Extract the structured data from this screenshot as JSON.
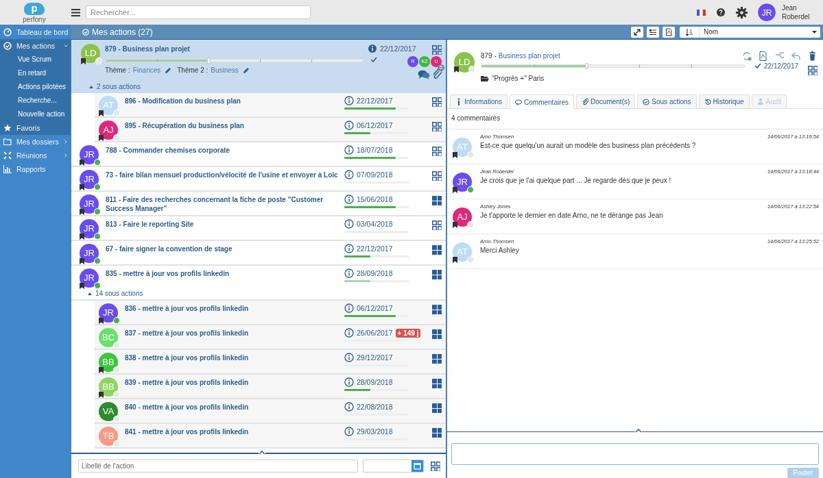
{
  "topbar": {
    "logo": {
      "mark": "p",
      "wordmark": "perfony"
    },
    "search": {
      "placeholder": "Rechercher..."
    },
    "user": {
      "initials": "JR",
      "name": "Jean Roberdel",
      "color": "#6a4cf0"
    }
  },
  "sidebar": {
    "items": [
      {
        "label": "Tableau de bord",
        "selected": false
      },
      {
        "label": "Mes actions",
        "selected": true,
        "expanded": true,
        "children": [
          {
            "label": "Vue Scrum"
          },
          {
            "label": "En retard"
          },
          {
            "label": "Actions pilotées"
          },
          {
            "label": "Recherche..."
          },
          {
            "label": "Nouvelle action"
          }
        ]
      },
      {
        "label": "Favoris",
        "selected": true
      },
      {
        "label": "Mes dossiers",
        "selected": false,
        "expanded": false
      },
      {
        "label": "Réunions",
        "selected": false,
        "expanded": false
      },
      {
        "label": "Rapports",
        "selected": false
      }
    ]
  },
  "list": {
    "title": "Mes actions (27)",
    "sort": {
      "value": "Nom"
    },
    "actions": [
      {
        "title": "879 - Business plan projet",
        "date": "22/12/2017",
        "avatar": {
          "initials": "LD",
          "color": "#8bc34a"
        },
        "online": false,
        "bookmarked": true,
        "selected": true,
        "level": 0.4,
        "board_filled": false,
        "themes": [
          {
            "label": "Thème :",
            "value": "Finances"
          },
          {
            "label": "Thème 2 :",
            "value": "Business"
          }
        ],
        "participants": [
          {
            "initials": "R",
            "color": "#6a4cf0"
          },
          {
            "initials": "KZ",
            "color": "#3cb93c"
          },
          {
            "initials": "U",
            "color": "#e0287a"
          }
        ],
        "attachments": "5",
        "subactions": "2 sous actions",
        "expanded": true,
        "children": [
          {
            "title": "896 - Modification du business plan",
            "date": "22/12/2017",
            "avatar": {
              "initials": "AT",
              "color": "#bcdcf7"
            },
            "online": false,
            "bookmarked": true,
            "selected": false,
            "level": 0.8,
            "board_filled": false
          },
          {
            "title": "895 - Récupération du business plan",
            "date": "06/12/2017",
            "avatar": {
              "initials": "AJ",
              "color": "#e0287a"
            },
            "online": false,
            "bookmarked": true,
            "selected": false,
            "level": 0.4,
            "board_filled": false
          }
        ]
      },
      {
        "title": "788 - Commander chemises corporate",
        "date": "18/07/2018",
        "avatar": {
          "initials": "JR",
          "color": "#6a4cf0"
        },
        "online": true,
        "bookmarked": true,
        "selected": false,
        "level": 0.8,
        "board_filled": false
      },
      {
        "title": "73 - faire bilan mensuel production/vélocité de l'usine et envoyer à Loïc",
        "date": "07/09/2018",
        "avatar": {
          "initials": "JR",
          "color": "#6a4cf0"
        },
        "online": true,
        "bookmarked": true,
        "selected": false,
        "level": 0,
        "board_filled": false
      },
      {
        "title": "811 - Faire des recherches concernant la fiche de poste \"Customer Success Manager\"",
        "date": "15/06/2018",
        "avatar": {
          "initials": "JR",
          "color": "#6a4cf0"
        },
        "online": true,
        "bookmarked": true,
        "selected": false,
        "level": 0.8,
        "board_filled": true
      },
      {
        "title": "813 - Faire le reporting Site",
        "date": "03/04/2018",
        "avatar": {
          "initials": "JR",
          "color": "#6a4cf0"
        },
        "online": true,
        "bookmarked": true,
        "selected": false,
        "level": 0,
        "board_filled": false
      },
      {
        "title": "67 - faire signer la convention de stage",
        "date": "22/12/2017",
        "avatar": {
          "initials": "JR",
          "color": "#6a4cf0"
        },
        "online": true,
        "bookmarked": true,
        "selected": false,
        "level": 0.4,
        "board_filled": true
      },
      {
        "title": "835 - mettre à jour vos profils linkedin",
        "date": "28/09/2018",
        "avatar": {
          "initials": "JR",
          "color": "#6a4cf0"
        },
        "online": true,
        "bookmarked": true,
        "selected": false,
        "level": 0.4,
        "board_filled": true,
        "subactions": "14 sous actions",
        "expanded": true,
        "children": [
          {
            "title": "836 - mettre à jour vos profils linkedin",
            "date": "06/12/2017",
            "avatar": {
              "initials": "JR",
              "color": "#6a4cf0"
            },
            "online": true,
            "bookmarked": true,
            "selected": false,
            "level": 0.8,
            "board_filled": true
          },
          {
            "title": "837 - mettre à jour vos profils linkedin",
            "date": "26/06/2017",
            "overdue": "+ 149 j",
            "avatar": {
              "initials": "BC",
              "color": "#6be06b"
            },
            "online": false,
            "bookmarked": false,
            "selected": false,
            "level": 0,
            "board_filled": true
          },
          {
            "title": "838 - mettre à jour vos profils linkedin",
            "date": "29/12/2017",
            "avatar": {
              "initials": "BB",
              "color": "#3cc63c"
            },
            "online": false,
            "bookmarked": true,
            "selected": false,
            "level": 0,
            "board_filled": true
          },
          {
            "title": "839 - mettre à jour vos profils linkedin",
            "date": "28/09/2018",
            "avatar": {
              "initials": "BB",
              "color": "#8fd460"
            },
            "online": false,
            "bookmarked": true,
            "selected": false,
            "level": 0.4,
            "board_filled": true
          },
          {
            "title": "840 - mettre à jour vos profils linkedin",
            "date": "22/08/2018",
            "avatar": {
              "initials": "VA",
              "color": "#2e8b2e"
            },
            "online": false,
            "bookmarked": false,
            "selected": false,
            "level": 0,
            "board_filled": true
          },
          {
            "title": "841 - mettre à jour vos profils linkedin",
            "date": "29/03/2018",
            "avatar": {
              "initials": "TB",
              "color": "#f99a85"
            },
            "online": false,
            "bookmarked": false,
            "selected": false,
            "level": 0,
            "board_filled": true
          }
        ]
      }
    ],
    "new_action": {
      "placeholder": "Libellé de l'action"
    }
  },
  "detail": {
    "prefix": "879 -",
    "title": "Business plan projet",
    "avatar": {
      "initials": "LD",
      "color": "#8bc34a"
    },
    "online": false,
    "bookmarked": true,
    "level": 0.4,
    "date": "22/12/2017",
    "done": true,
    "folder": "\"Progrès +\" Paris",
    "tabs": [
      {
        "label": "Informations",
        "selected": false,
        "disabled": false
      },
      {
        "label": "Commentaires",
        "selected": true,
        "disabled": false
      },
      {
        "label": "Document(s)",
        "selected": false,
        "disabled": false
      },
      {
        "label": "Sous actions",
        "selected": false,
        "disabled": false
      },
      {
        "label": "Historique",
        "selected": false,
        "disabled": false
      },
      {
        "label": "Audit",
        "selected": false,
        "disabled": true
      }
    ],
    "comment_count": "4 commentaires",
    "comments": [
      {
        "author": "Arno Thomsen",
        "time": "14/06/2017 à 13:16:54",
        "text": "Est-ce que quelqu'un aurait un modèle des business plan précédents ?",
        "avatar": {
          "initials": "AT",
          "color": "#bcdcf7"
        },
        "online": false,
        "bookmarked": true
      },
      {
        "author": "Jean Roberdel",
        "time": "14/06/2017 à 13:18:44",
        "text": "Je crois que je l'ai quelque part ... Je regarde dès que je peux !",
        "avatar": {
          "initials": "JR",
          "color": "#6a4cf0"
        },
        "online": true,
        "bookmarked": true
      },
      {
        "author": "Ashley Jones",
        "time": "14/06/2017 à 13:22:54",
        "text": "Je t'apporte le dernier en date Arno, ne te dérange pas Jean",
        "avatar": {
          "initials": "AJ",
          "color": "#e0287a"
        },
        "online": false,
        "bookmarked": true
      },
      {
        "author": "Arno Thomsen",
        "time": "14/06/2017 à 13:25:52",
        "text": "Merci Ashley",
        "avatar": {
          "initials": "AT",
          "color": "#bcdcf7"
        },
        "online": false,
        "bookmarked": true
      }
    ],
    "composer": {
      "button": "Poster",
      "disabled": true
    }
  }
}
